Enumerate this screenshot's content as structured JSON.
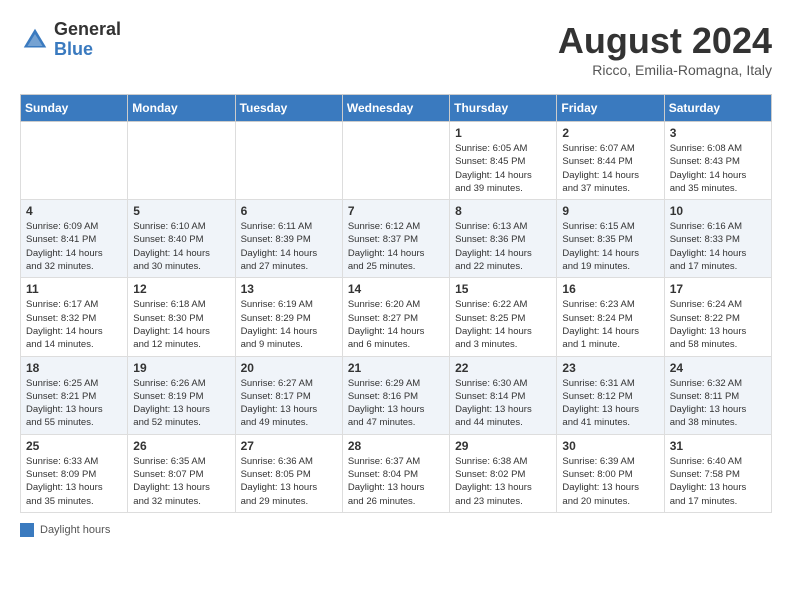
{
  "header": {
    "logo": {
      "general": "General",
      "blue": "Blue"
    },
    "title": "August 2024",
    "location": "Ricco, Emilia-Romagna, Italy"
  },
  "calendar": {
    "days_of_week": [
      "Sunday",
      "Monday",
      "Tuesday",
      "Wednesday",
      "Thursday",
      "Friday",
      "Saturday"
    ],
    "weeks": [
      [
        {
          "day": "",
          "info": ""
        },
        {
          "day": "",
          "info": ""
        },
        {
          "day": "",
          "info": ""
        },
        {
          "day": "",
          "info": ""
        },
        {
          "day": "1",
          "info": "Sunrise: 6:05 AM\nSunset: 8:45 PM\nDaylight: 14 hours\nand 39 minutes."
        },
        {
          "day": "2",
          "info": "Sunrise: 6:07 AM\nSunset: 8:44 PM\nDaylight: 14 hours\nand 37 minutes."
        },
        {
          "day": "3",
          "info": "Sunrise: 6:08 AM\nSunset: 8:43 PM\nDaylight: 14 hours\nand 35 minutes."
        }
      ],
      [
        {
          "day": "4",
          "info": "Sunrise: 6:09 AM\nSunset: 8:41 PM\nDaylight: 14 hours\nand 32 minutes."
        },
        {
          "day": "5",
          "info": "Sunrise: 6:10 AM\nSunset: 8:40 PM\nDaylight: 14 hours\nand 30 minutes."
        },
        {
          "day": "6",
          "info": "Sunrise: 6:11 AM\nSunset: 8:39 PM\nDaylight: 14 hours\nand 27 minutes."
        },
        {
          "day": "7",
          "info": "Sunrise: 6:12 AM\nSunset: 8:37 PM\nDaylight: 14 hours\nand 25 minutes."
        },
        {
          "day": "8",
          "info": "Sunrise: 6:13 AM\nSunset: 8:36 PM\nDaylight: 14 hours\nand 22 minutes."
        },
        {
          "day": "9",
          "info": "Sunrise: 6:15 AM\nSunset: 8:35 PM\nDaylight: 14 hours\nand 19 minutes."
        },
        {
          "day": "10",
          "info": "Sunrise: 6:16 AM\nSunset: 8:33 PM\nDaylight: 14 hours\nand 17 minutes."
        }
      ],
      [
        {
          "day": "11",
          "info": "Sunrise: 6:17 AM\nSunset: 8:32 PM\nDaylight: 14 hours\nand 14 minutes."
        },
        {
          "day": "12",
          "info": "Sunrise: 6:18 AM\nSunset: 8:30 PM\nDaylight: 14 hours\nand 12 minutes."
        },
        {
          "day": "13",
          "info": "Sunrise: 6:19 AM\nSunset: 8:29 PM\nDaylight: 14 hours\nand 9 minutes."
        },
        {
          "day": "14",
          "info": "Sunrise: 6:20 AM\nSunset: 8:27 PM\nDaylight: 14 hours\nand 6 minutes."
        },
        {
          "day": "15",
          "info": "Sunrise: 6:22 AM\nSunset: 8:25 PM\nDaylight: 14 hours\nand 3 minutes."
        },
        {
          "day": "16",
          "info": "Sunrise: 6:23 AM\nSunset: 8:24 PM\nDaylight: 14 hours\nand 1 minute."
        },
        {
          "day": "17",
          "info": "Sunrise: 6:24 AM\nSunset: 8:22 PM\nDaylight: 13 hours\nand 58 minutes."
        }
      ],
      [
        {
          "day": "18",
          "info": "Sunrise: 6:25 AM\nSunset: 8:21 PM\nDaylight: 13 hours\nand 55 minutes."
        },
        {
          "day": "19",
          "info": "Sunrise: 6:26 AM\nSunset: 8:19 PM\nDaylight: 13 hours\nand 52 minutes."
        },
        {
          "day": "20",
          "info": "Sunrise: 6:27 AM\nSunset: 8:17 PM\nDaylight: 13 hours\nand 49 minutes."
        },
        {
          "day": "21",
          "info": "Sunrise: 6:29 AM\nSunset: 8:16 PM\nDaylight: 13 hours\nand 47 minutes."
        },
        {
          "day": "22",
          "info": "Sunrise: 6:30 AM\nSunset: 8:14 PM\nDaylight: 13 hours\nand 44 minutes."
        },
        {
          "day": "23",
          "info": "Sunrise: 6:31 AM\nSunset: 8:12 PM\nDaylight: 13 hours\nand 41 minutes."
        },
        {
          "day": "24",
          "info": "Sunrise: 6:32 AM\nSunset: 8:11 PM\nDaylight: 13 hours\nand 38 minutes."
        }
      ],
      [
        {
          "day": "25",
          "info": "Sunrise: 6:33 AM\nSunset: 8:09 PM\nDaylight: 13 hours\nand 35 minutes."
        },
        {
          "day": "26",
          "info": "Sunrise: 6:35 AM\nSunset: 8:07 PM\nDaylight: 13 hours\nand 32 minutes."
        },
        {
          "day": "27",
          "info": "Sunrise: 6:36 AM\nSunset: 8:05 PM\nDaylight: 13 hours\nand 29 minutes."
        },
        {
          "day": "28",
          "info": "Sunrise: 6:37 AM\nSunset: 8:04 PM\nDaylight: 13 hours\nand 26 minutes."
        },
        {
          "day": "29",
          "info": "Sunrise: 6:38 AM\nSunset: 8:02 PM\nDaylight: 13 hours\nand 23 minutes."
        },
        {
          "day": "30",
          "info": "Sunrise: 6:39 AM\nSunset: 8:00 PM\nDaylight: 13 hours\nand 20 minutes."
        },
        {
          "day": "31",
          "info": "Sunrise: 6:40 AM\nSunset: 7:58 PM\nDaylight: 13 hours\nand 17 minutes."
        }
      ]
    ]
  },
  "footer": {
    "legend_label": "Daylight hours"
  }
}
